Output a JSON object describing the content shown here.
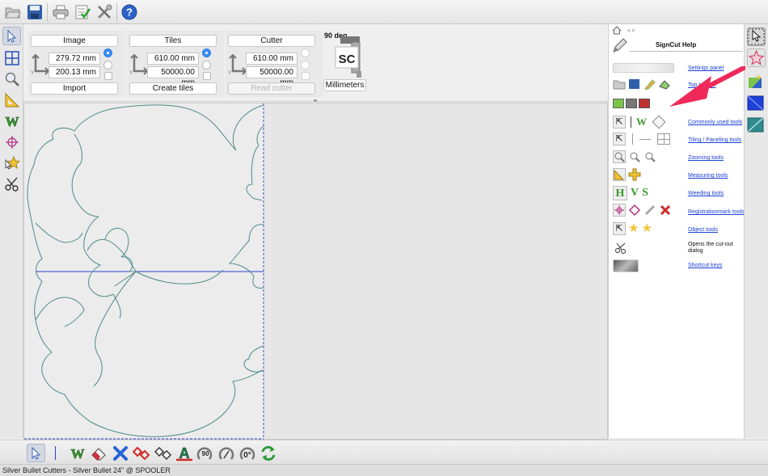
{
  "settings": {
    "image": {
      "label": "Image",
      "width": "279.72 mm",
      "height": "200.13 mm",
      "button": "Import"
    },
    "tiles": {
      "label": "Tiles",
      "width": "610.00 mm",
      "height": "50000.00 mm",
      "button": "Create tiles"
    },
    "cutter": {
      "label": "Cutter",
      "width": "610.00 mm",
      "height": "50000.00 mm",
      "button": "Read cutter"
    },
    "rotation_label": "90 deg",
    "logo_text": "SC",
    "units_button": "Millimeters"
  },
  "help": {
    "title": "SignCut Help",
    "items": [
      {
        "label": "Settings panel"
      },
      {
        "label": "Top toolbar"
      },
      {
        "label": "Commonly used tools"
      },
      {
        "label": "Tiling / Paneling tools"
      },
      {
        "label": "Zooming tools"
      },
      {
        "label": "Measuring tools"
      },
      {
        "label": "Weeding tools"
      },
      {
        "label": "Registrationmark tools"
      },
      {
        "label": "Object tools"
      },
      {
        "label": "Opens the cut-out dialog"
      },
      {
        "label": "Shortcut keys"
      }
    ],
    "weeding_letters": [
      "H",
      "V",
      "S"
    ]
  },
  "bottom_toolbar": {
    "rotate_90_label": "90",
    "rotate_0_label": "0°"
  },
  "status": {
    "text": "Silver Bullet Cutters - Silver Bullet 24\" @ SPOOLER"
  },
  "colors": {
    "accent_blue": "#3d8ef5",
    "arrow_red": "#ef2a5a",
    "cut_line": "#4f8a8b",
    "guide_line": "#2a3fd0",
    "link": "#1a3fd6"
  }
}
